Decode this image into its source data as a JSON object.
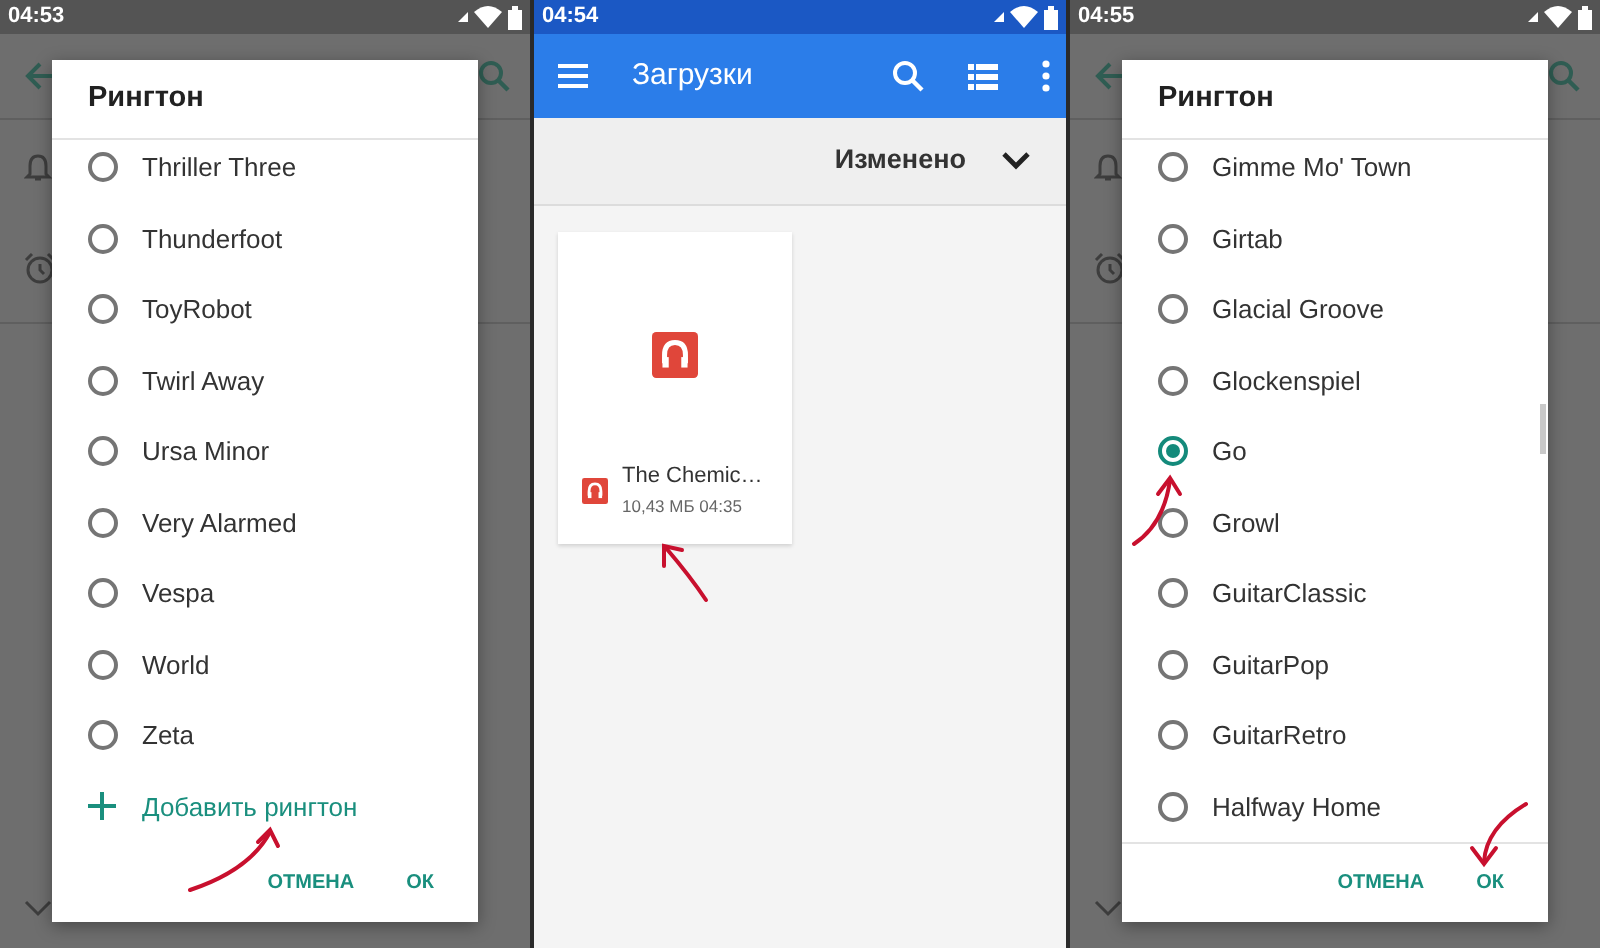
{
  "panels": [
    {
      "kind": "ringtone_dialog",
      "status_bar": {
        "time": "04:53"
      },
      "dialog": {
        "title": "Рингтон",
        "options": [
          {
            "label": "Thriller Three",
            "selected": false
          },
          {
            "label": "Thunderfoot",
            "selected": false
          },
          {
            "label": "ToyRobot",
            "selected": false
          },
          {
            "label": "Twirl Away",
            "selected": false
          },
          {
            "label": "Ursa Minor",
            "selected": false
          },
          {
            "label": "Very Alarmed",
            "selected": false
          },
          {
            "label": "Vespa",
            "selected": false
          },
          {
            "label": "World",
            "selected": false
          },
          {
            "label": "Zeta",
            "selected": false
          }
        ],
        "add_action": "Добавить рингтон",
        "buttons": [
          "ОТМЕНА",
          "ОК"
        ]
      }
    },
    {
      "kind": "downloads",
      "status_bar": {
        "time": "04:54"
      },
      "app_bar": {
        "title": "Загрузки"
      },
      "sort": {
        "label": "Изменено"
      },
      "files": [
        {
          "name": "The Chemic…",
          "meta": "10,43 МБ 04:35"
        }
      ]
    },
    {
      "kind": "ringtone_dialog",
      "status_bar": {
        "time": "04:55"
      },
      "dialog": {
        "title": "Рингтон",
        "options": [
          {
            "label": "Gimme Mo' Town",
            "selected": false
          },
          {
            "label": "Girtab",
            "selected": false
          },
          {
            "label": "Glacial Groove",
            "selected": false
          },
          {
            "label": "Glockenspiel",
            "selected": false
          },
          {
            "label": "Go",
            "selected": true
          },
          {
            "label": "Growl",
            "selected": false
          },
          {
            "label": "GuitarClassic",
            "selected": false
          },
          {
            "label": "GuitarPop",
            "selected": false
          },
          {
            "label": "GuitarRetro",
            "selected": false
          },
          {
            "label": "Halfway Home",
            "selected": false
          }
        ],
        "buttons": [
          "ОТМЕНА",
          "ОК"
        ]
      }
    }
  ]
}
